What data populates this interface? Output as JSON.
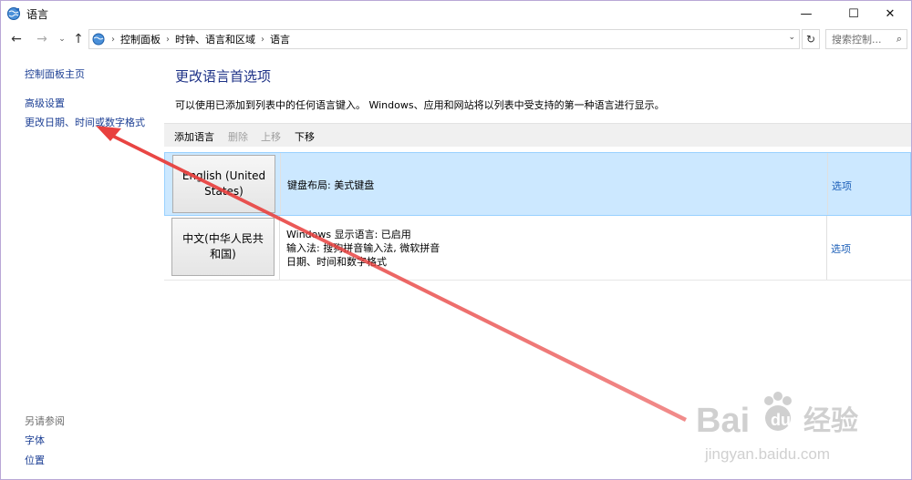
{
  "window": {
    "title": "语言",
    "minimize": "—",
    "maximize": "☐",
    "close": "✕"
  },
  "nav": {
    "back": "←",
    "forward": "→",
    "recent": "⌄",
    "up": "↑",
    "breadcrumbs": [
      "控制面板",
      "时钟、语言和区域",
      "语言"
    ],
    "separator": "›",
    "dropdown": "⌄",
    "refresh": "↻",
    "search_placeholder": "搜索控制...",
    "search_icon": "⌕"
  },
  "sidebar": {
    "home": "控制面板主页",
    "advanced": "高级设置",
    "change_date": "更改日期、时间或数字格式",
    "see_also": "另请参阅",
    "fonts": "字体",
    "location": "位置"
  },
  "main": {
    "title": "更改语言首选项",
    "description": "可以使用已添加到列表中的任何语言键入。 Windows、应用和网站将以列表中受支持的第一种语言进行显示。",
    "toolbar": {
      "add": "添加语言",
      "remove": "删除",
      "move_up": "上移",
      "move_down": "下移"
    },
    "languages": [
      {
        "name": "English (United States)",
        "info": [
          "键盘布局: 美式键盘"
        ],
        "options": "选项"
      },
      {
        "name": "中文(中华人民共和国)",
        "info": [
          "Windows 显示语言: 已启用",
          "输入法: 搜狗拼音输入法, 微软拼音",
          "日期、时间和数字格式"
        ],
        "options": "选项"
      }
    ]
  },
  "watermark": {
    "brand": "Baidu",
    "brand_cn": "经验",
    "url": "jingyan.baidu.com"
  },
  "colors": {
    "link": "#1c3f94",
    "selection": "#cce8ff",
    "annotation_arrow": "#e8403e"
  }
}
